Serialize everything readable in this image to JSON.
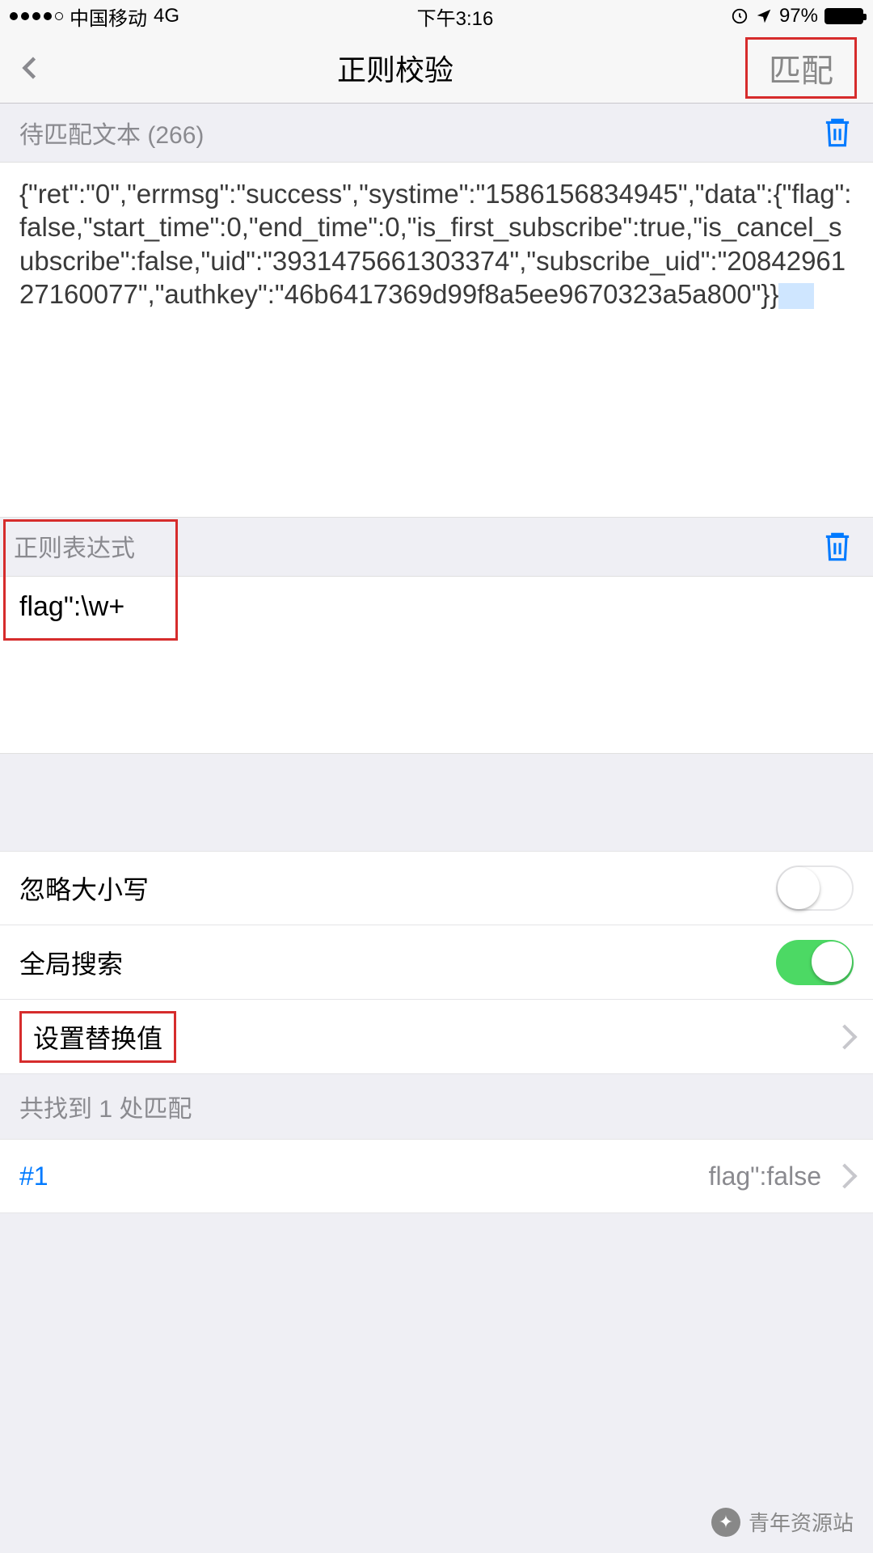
{
  "statusbar": {
    "carrier": "中国移动",
    "network": "4G",
    "time": "下午3:16",
    "battery_pct": "97%"
  },
  "nav": {
    "title": "正则校验",
    "match_button": "匹配"
  },
  "input_section": {
    "header": "待匹配文本 (266)",
    "text": "{\"ret\":\"0\",\"errmsg\":\"success\",\"systime\":\"1586156834945\",\"data\":{\"flag\":false,\"start_time\":0,\"end_time\":0,\"is_first_subscribe\":true,\"is_cancel_subscribe\":false,\"uid\":\"3931475661303374\",\"subscribe_uid\":\"2084296127160077\",\"authkey\":\"46b6417369d99f8a5ee9670323a5a800\"}}"
  },
  "regex_section": {
    "header": "正则表达式",
    "pattern": "flag\":\\w+"
  },
  "options": {
    "ignore_case_label": "忽略大小写",
    "ignore_case_on": false,
    "global_label": "全局搜索",
    "global_on": true,
    "replace_label": "设置替换值"
  },
  "results": {
    "header": "共找到 1 处匹配",
    "items": [
      {
        "index": "#1",
        "value": "flag\":false"
      }
    ]
  },
  "watermark": "青年资源站"
}
